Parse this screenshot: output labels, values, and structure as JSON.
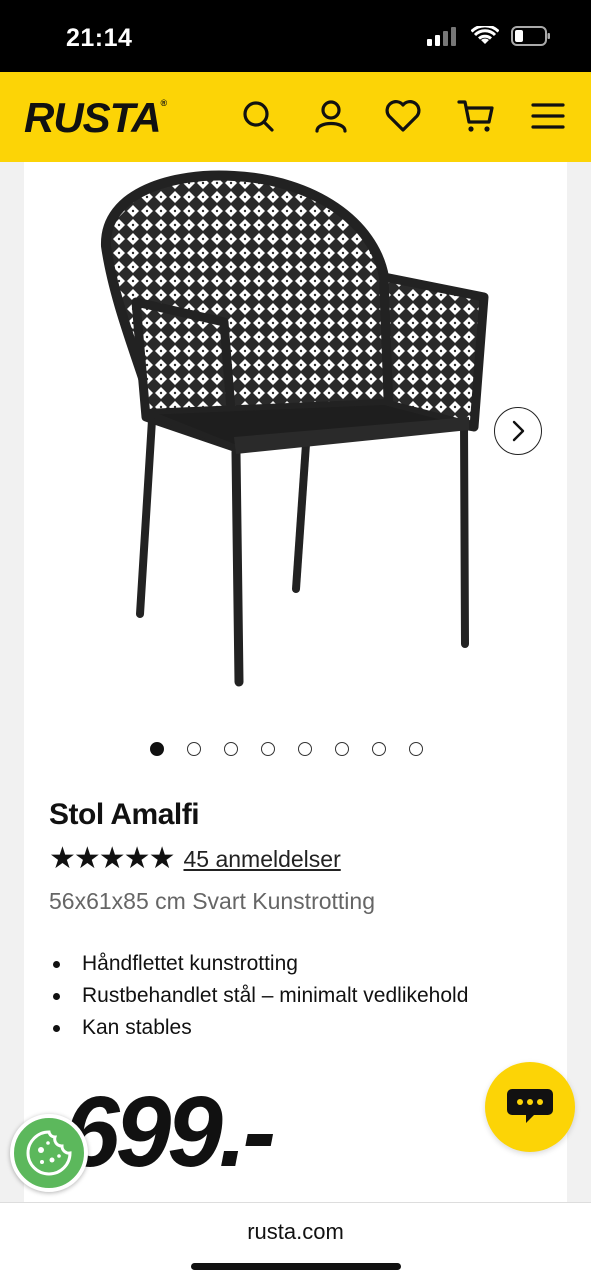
{
  "status_bar": {
    "time": "21:14"
  },
  "header": {
    "logo": "RUSTA",
    "logo_mark": "®",
    "icons": [
      "search-icon",
      "account-icon",
      "heart-icon",
      "cart-icon",
      "menu-icon"
    ],
    "bg_color": "#fcd406"
  },
  "gallery": {
    "image_count": 8,
    "active_index": 0
  },
  "product": {
    "title": "Stol Amalfi",
    "stars": "★★★★★",
    "rating": 5,
    "reviews": "45 anmeldelser",
    "subtitle": "56x61x85 cm Svart Kunstrotting",
    "features": [
      "Håndflettet kunstrotting",
      "Rustbehandlet stål – minimalt vedlikehold",
      "Kan stables"
    ],
    "price": "699.-"
  },
  "browser": {
    "url": "rusta.com"
  }
}
